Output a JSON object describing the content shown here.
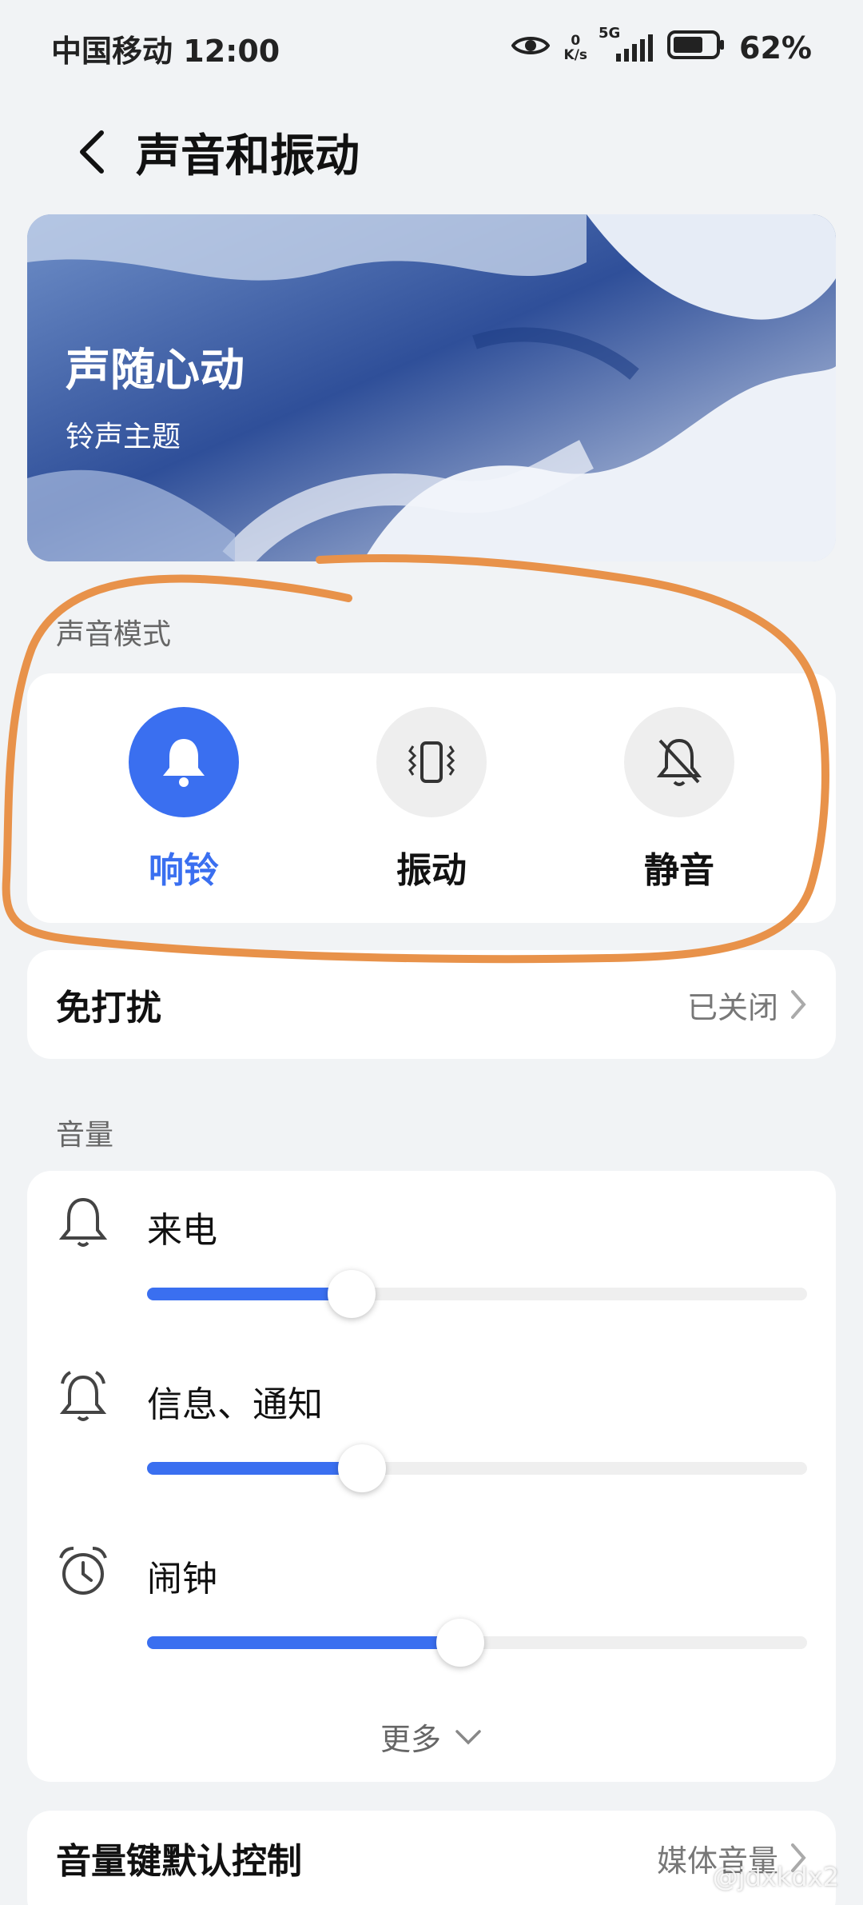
{
  "status_bar": {
    "carrier": "中国移动",
    "time": "12:00",
    "network_speed_value": "0",
    "network_speed_unit": "K/s",
    "network_type": "5G",
    "battery_percent": "62%",
    "icons": [
      "eye-icon",
      "signal-icon",
      "battery-icon"
    ]
  },
  "header": {
    "title": "声音和振动",
    "back_icon": "chevron-left-icon"
  },
  "banner": {
    "title": "声随心动",
    "subtitle": "铃声主题"
  },
  "sound_mode": {
    "section_label": "声音模式",
    "selected": "响铃",
    "modes": [
      {
        "label": "响铃",
        "icon": "bell-icon",
        "active": true
      },
      {
        "label": "振动",
        "icon": "vibrate-icon",
        "active": false
      },
      {
        "label": "静音",
        "icon": "bell-off-icon",
        "active": false
      }
    ]
  },
  "dnd": {
    "label": "免打扰",
    "value": "已关闭"
  },
  "volume": {
    "section_label": "音量",
    "items": [
      {
        "label": "来电",
        "icon": "bell-outline-icon",
        "level": 0.31
      },
      {
        "label": "信息、通知",
        "icon": "bell-ringing-icon",
        "level": 0.326
      },
      {
        "label": "闹钟",
        "icon": "alarm-clock-icon",
        "level": 0.475
      }
    ],
    "more_label": "更多"
  },
  "volume_key": {
    "label": "音量键默认控制",
    "value": "媒体音量"
  },
  "watermark": "@jdxkdx2",
  "colors": {
    "accent": "#3a6ff0",
    "background": "#f1f3f5",
    "annotation": "#e8924a"
  }
}
